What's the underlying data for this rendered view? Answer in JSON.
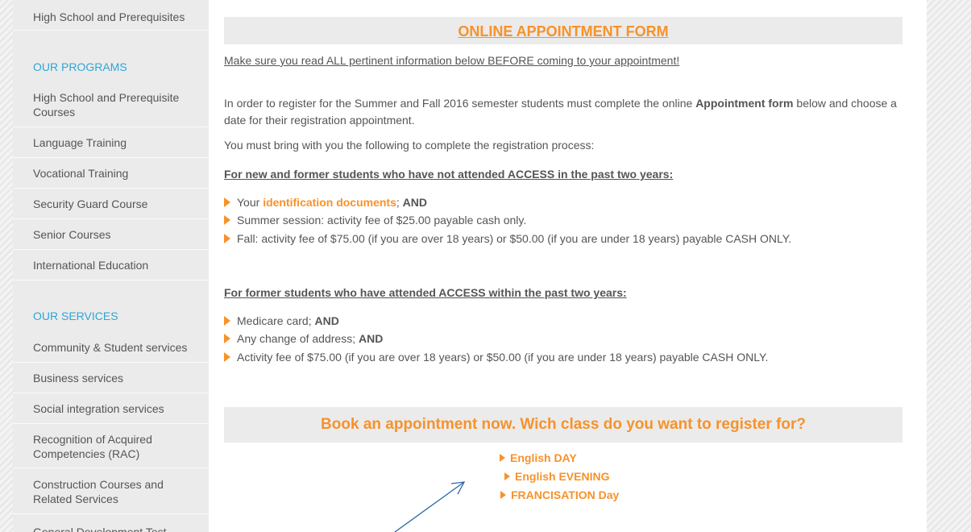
{
  "sidebar": {
    "top_item": "High School and Prerequisites",
    "programs_heading": "OUR PROGRAMS",
    "programs": [
      "High School and Prerequisite Courses",
      "Language Training",
      "Vocational Training",
      "Security Guard Course",
      "Senior Courses",
      "International Education"
    ],
    "services_heading": "OUR SERVICES",
    "services": [
      "Community & Student services",
      "Business services",
      "Social integration services",
      "Recognition of Acquired Competencies (RAC)",
      "Construction Courses and Related Services",
      "General Development Test"
    ]
  },
  "main": {
    "form_title": "ONLINE APPOINTMENT FORM",
    "notice": "Make sure you read ALL pertinent information below BEFORE coming to your appointment!",
    "intro_part1": "In order to register for the Summer and Fall 2016 semester students must complete the online ",
    "intro_bold": "Appointment form",
    "intro_part2": " below and choose a date for their registration appointment.",
    "bring_text": "You must bring with you the following to complete the registration process:",
    "new_students_heading": "For new and former students who have not attended ACCESS in the past two years:",
    "new_students_items": {
      "item1_prefix": "Your ",
      "item1_link": "identification documents",
      "item1_suffix": "; ",
      "and": "AND",
      "item2": "Summer session: activity fee of $25.00 payable cash only.",
      "item3": "Fall: activity fee of $75.00 (if you are over 18 years) or $50.00 (if you are under 18 years) payable CASH ONLY."
    },
    "former_students_heading": "For former students who have attended ACCESS within the past two years:",
    "former_students_items": {
      "item1": "Medicare card; ",
      "item2": "Any change of address; ",
      "item3": "Activity fee of $75.00 (if you are over 18 years) or $50.00 (if you are under 18 years) payable CASH ONLY."
    },
    "book_text": "Book an appointment now. Wich class do you want to register for?",
    "class_links": [
      "English DAY",
      "English EVENING",
      "FRANCISATION Day"
    ]
  }
}
